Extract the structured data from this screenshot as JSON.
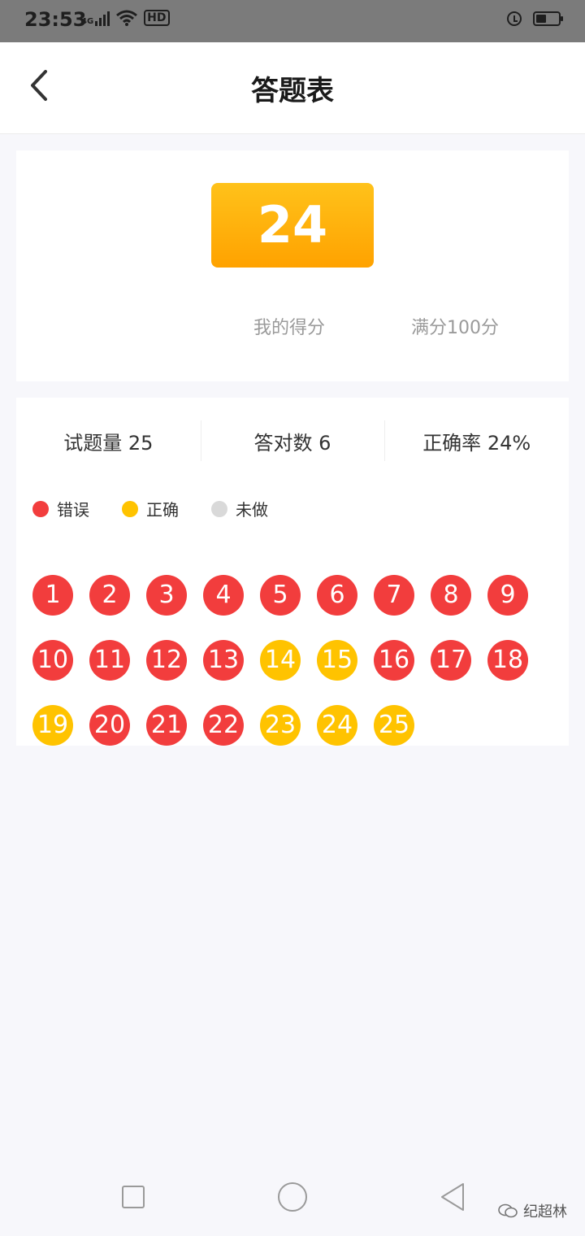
{
  "status_bar": {
    "time": "23:53",
    "network": "4G",
    "hd": "HD"
  },
  "header": {
    "title": "答题表"
  },
  "score": {
    "value": "24",
    "my_score_label": "我的得分",
    "full_score_label": "满分100分"
  },
  "stats": [
    {
      "label": "试题量 25"
    },
    {
      "label": "答对数 6"
    },
    {
      "label": "正确率 24%"
    }
  ],
  "legend": [
    {
      "label": "错误",
      "color": "#f23d3d"
    },
    {
      "label": "正确",
      "color": "#ffc300"
    },
    {
      "label": "未做",
      "color": "#d9d9d9"
    }
  ],
  "colors": {
    "wrong": "#f23d3d",
    "correct": "#ffc300",
    "undone": "#d9d9d9"
  },
  "questions": [
    {
      "n": "1",
      "status": "wrong"
    },
    {
      "n": "2",
      "status": "wrong"
    },
    {
      "n": "3",
      "status": "wrong"
    },
    {
      "n": "4",
      "status": "wrong"
    },
    {
      "n": "5",
      "status": "wrong"
    },
    {
      "n": "6",
      "status": "wrong"
    },
    {
      "n": "7",
      "status": "wrong"
    },
    {
      "n": "8",
      "status": "wrong"
    },
    {
      "n": "9",
      "status": "wrong"
    },
    {
      "n": "10",
      "status": "wrong"
    },
    {
      "n": "11",
      "status": "wrong"
    },
    {
      "n": "12",
      "status": "wrong"
    },
    {
      "n": "13",
      "status": "wrong"
    },
    {
      "n": "14",
      "status": "correct"
    },
    {
      "n": "15",
      "status": "correct"
    },
    {
      "n": "16",
      "status": "wrong"
    },
    {
      "n": "17",
      "status": "wrong"
    },
    {
      "n": "18",
      "status": "wrong"
    },
    {
      "n": "19",
      "status": "correct"
    },
    {
      "n": "20",
      "status": "wrong"
    },
    {
      "n": "21",
      "status": "wrong"
    },
    {
      "n": "22",
      "status": "wrong"
    },
    {
      "n": "23",
      "status": "correct"
    },
    {
      "n": "24",
      "status": "correct"
    },
    {
      "n": "25",
      "status": "correct"
    }
  ],
  "watermark": {
    "text": "纪超林"
  }
}
